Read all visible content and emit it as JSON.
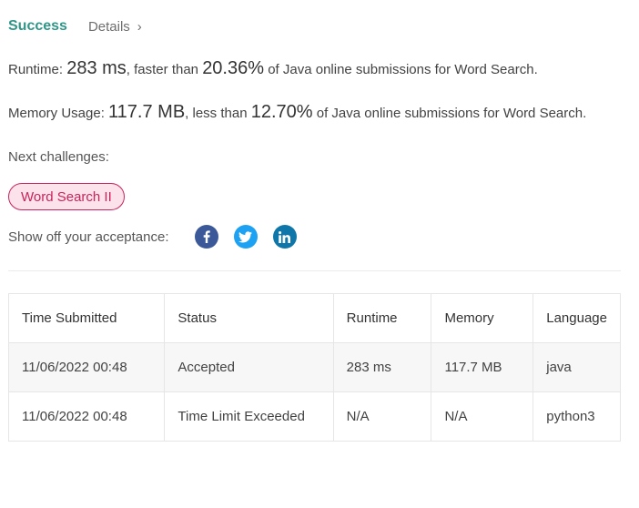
{
  "header": {
    "status": "Success",
    "details_label": "Details",
    "chevron": "›"
  },
  "runtime": {
    "label": "Runtime:",
    "value": "283 ms",
    "middle": ", faster than",
    "percent": "20.36%",
    "suffix": "of Java online submissions for Word Search."
  },
  "memory": {
    "label": "Memory Usage:",
    "value": "117.7 MB",
    "middle": ", less than",
    "percent": "12.70%",
    "suffix": "of Java online submissions for Word Search."
  },
  "next": {
    "label": "Next challenges:",
    "challenges": [
      "Word Search II"
    ]
  },
  "share": {
    "label": "Show off your acceptance:",
    "icons": [
      {
        "name": "facebook-icon",
        "glyph": "f",
        "color": "#3b5998"
      },
      {
        "name": "twitter-icon",
        "glyph": "t",
        "color": "#1da1f2"
      },
      {
        "name": "linkedin-icon",
        "glyph": "in",
        "color": "#0e76a8"
      }
    ]
  },
  "table": {
    "headers": [
      "Time Submitted",
      "Status",
      "Runtime",
      "Memory",
      "Language"
    ],
    "rows": [
      {
        "time": "11/06/2022 00:48",
        "status": "Accepted",
        "status_type": "accepted",
        "runtime": "283 ms",
        "memory": "117.7 MB",
        "language": "java"
      },
      {
        "time": "11/06/2022 00:48",
        "status": "Time Limit Exceeded",
        "status_type": "tle",
        "runtime": "N/A",
        "memory": "N/A",
        "language": "python3"
      }
    ]
  },
  "colors": {
    "success": "#2f9688",
    "error": "#c0392b",
    "pill_border": "#c9245b",
    "pill_bg": "#fce2ea"
  }
}
